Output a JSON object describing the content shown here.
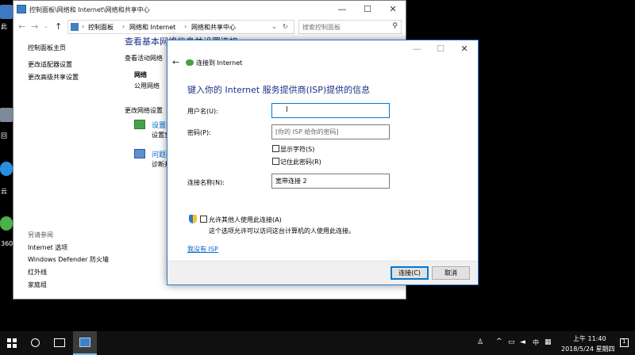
{
  "desktop": {
    "labels": [
      "此",
      "回",
      "云",
      "360"
    ]
  },
  "cp_window": {
    "title": "控制面板\\网络和 Internet\\网络和共享中心",
    "minimize": "—",
    "maximize": "☐",
    "close": "✕",
    "breadcrumbs": [
      "控制面板",
      "网络和 Internet",
      "网络和共享中心"
    ],
    "search_placeholder": "搜索控制面板",
    "left_links": [
      "控制面板主页",
      "更改适配器设置",
      "更改高级共享设置"
    ],
    "see_also_header": "另请参阅",
    "see_also": [
      "Internet 选项",
      "Windows Defender 防火墙",
      "红外线",
      "家庭组"
    ],
    "main_title": "查看基本网络信息并设置连接",
    "active_networks": "查看活动网络",
    "network_name": "网络",
    "network_type": "公用网络",
    "change_settings": "更改网络设置",
    "setting1_link": "设置新",
    "setting1_desc": "设置宽",
    "setting2_link": "问题疑",
    "setting2_desc": "诊断并"
  },
  "dialog": {
    "title": "连接到 Internet",
    "heading": "键入你的 Internet 服务提供商(ISP)提供的信息",
    "username_label": "用户名(U):",
    "username_value": "",
    "password_label": "密码(P):",
    "password_placeholder": "[你的 ISP 给你的密码]",
    "show_chars": "显示字符(S)",
    "remember_pw": "记住此密码(R)",
    "conn_name_label": "连接名称(N):",
    "conn_name_value": "宽带连接 2",
    "allow_others": "允许其他人使用此连接(A)",
    "allow_desc": "这个选项允许可以访问这台计算机的人使用此连接。",
    "no_isp": "我没有 ISP",
    "connect_btn": "连接(C)",
    "cancel_btn": "取消",
    "minimize": "—",
    "maximize": "☐",
    "close": "✕"
  },
  "taskbar": {
    "ime": "中",
    "time": "上午 11:40",
    "date": "2018/5/24 星期四",
    "notification_count": "1"
  },
  "colors": {
    "accent": "#0078d7",
    "heading": "#1e3287",
    "link": "#0066cc"
  }
}
